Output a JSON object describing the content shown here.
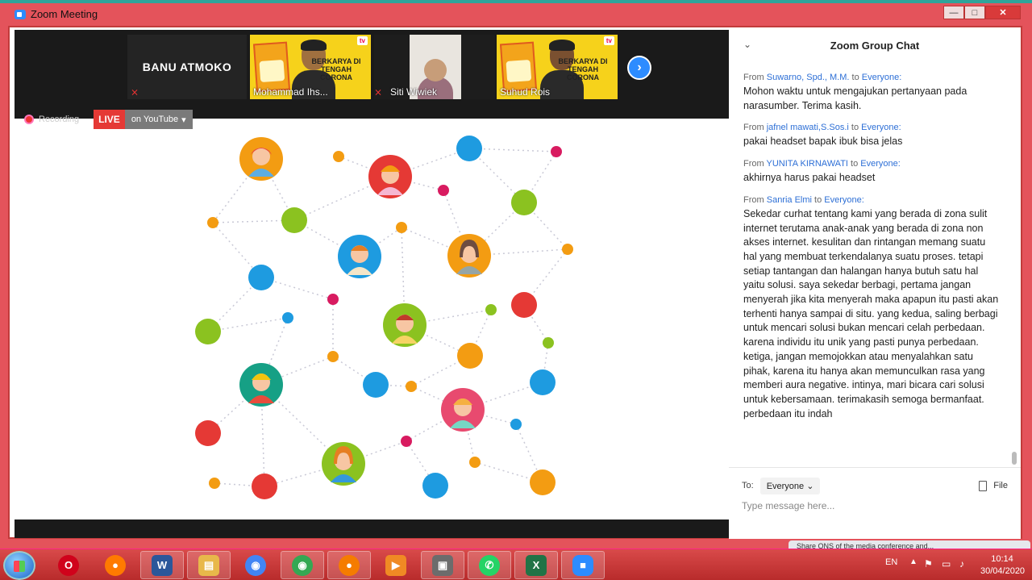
{
  "window": {
    "title": "Zoom Meeting",
    "controls": [
      "—",
      "□",
      "✕"
    ]
  },
  "thumbnails": {
    "banu": {
      "name": "BANU ATMOKO"
    },
    "mohammad": {
      "name": "Mohammad Ihs...",
      "banner": "BERKARYA DI TENGAH CORONA",
      "logo": "tv"
    },
    "siti": {
      "name": "Siti Wiwiek"
    },
    "suhud": {
      "name": "Suhud Rois",
      "banner": "BERKARYA DI TENGAH CORONA",
      "logo": "tv"
    },
    "next_icon": "chevron-right-icon"
  },
  "status": {
    "recording": "Recording",
    "live": "LIVE",
    "youtube": "on YouTube"
  },
  "colors": {
    "zoom_blue": "#2d8cff",
    "live_red": "#e53935",
    "window_red": "#e4535b"
  },
  "chat": {
    "title": "Zoom Group Chat",
    "messages": [
      {
        "from": "From",
        "sender": "Suwarno, Spd., M.M.",
        "to_word": "to",
        "recipient": "Everyone:",
        "text": "Mohon waktu untuk mengajukan pertanyaan pada narasumber. Terima kasih."
      },
      {
        "from": "From",
        "sender": "jafnel mawati,S.Sos.i",
        "to_word": "to",
        "recipient": "Everyone:",
        "text": "pakai headset bapak ibuk bisa jelas"
      },
      {
        "from": "From",
        "sender": "YUNITA KIRNAWATI",
        "to_word": "to",
        "recipient": "Everyone:",
        "text": "akhirnya harus pakai headset"
      },
      {
        "from": "From",
        "sender": "Sanria Elmi",
        "to_word": "to",
        "recipient": "Everyone:",
        "text": "Sekedar curhat tentang kami yang berada di zona sulit internet terutama anak-anak yang berada di zona non akses internet. kesulitan dan rintangan memang suatu hal yang membuat terkendalanya suatu proses. tetapi setiap tantangan dan halangan hanya butuh satu hal yaitu solusi. saya sekedar berbagi, pertama jangan menyerah jika kita menyerah maka apapun itu pasti akan terhenti hanya sampai di situ. yang kedua, saling berbagi untuk mencari solusi bukan mencari celah perbedaan. karena individu itu unik yang pasti punya perbedaan. ketiga, jangan memojokkan atau menyalahkan satu pihak, karena itu hanya akan memunculkan rasa yang memberi aura negative. intinya, mari bicara cari solusi untuk kebersamaan. terimakasih semoga bermanfaat. perbedaan itu indah"
      }
    ],
    "to_label": "To:",
    "to_value": "Everyone",
    "file_label": "File",
    "input_placeholder": "Type message here..."
  },
  "notification": {
    "text": "Share ONS of the media conference and..."
  },
  "taskbar": {
    "apps": [
      {
        "name": "opera",
        "glyph": "O",
        "color": "#d0021b"
      },
      {
        "name": "firefox",
        "glyph": "●",
        "color": "#ff7a00"
      },
      {
        "name": "word",
        "glyph": "W",
        "color": "#2b579a"
      },
      {
        "name": "explorer",
        "glyph": "▤",
        "color": "#e8b84a"
      },
      {
        "name": "chrome",
        "glyph": "◉",
        "color": "#4285f4"
      },
      {
        "name": "chrome-profile",
        "glyph": "◉",
        "color": "#34a853"
      },
      {
        "name": "avast",
        "glyph": "●",
        "color": "#f57c00"
      },
      {
        "name": "media-player",
        "glyph": "▶",
        "color": "#f08a24"
      },
      {
        "name": "remote-desktop",
        "glyph": "▣",
        "color": "#6c6c6c"
      },
      {
        "name": "whatsapp",
        "glyph": "✆",
        "color": "#25d366"
      },
      {
        "name": "excel",
        "glyph": "X",
        "color": "#217346"
      },
      {
        "name": "zoom",
        "glyph": "■",
        "color": "#2d8cff"
      }
    ],
    "lang": "EN",
    "time": "10:14",
    "date": "30/04/2020"
  }
}
